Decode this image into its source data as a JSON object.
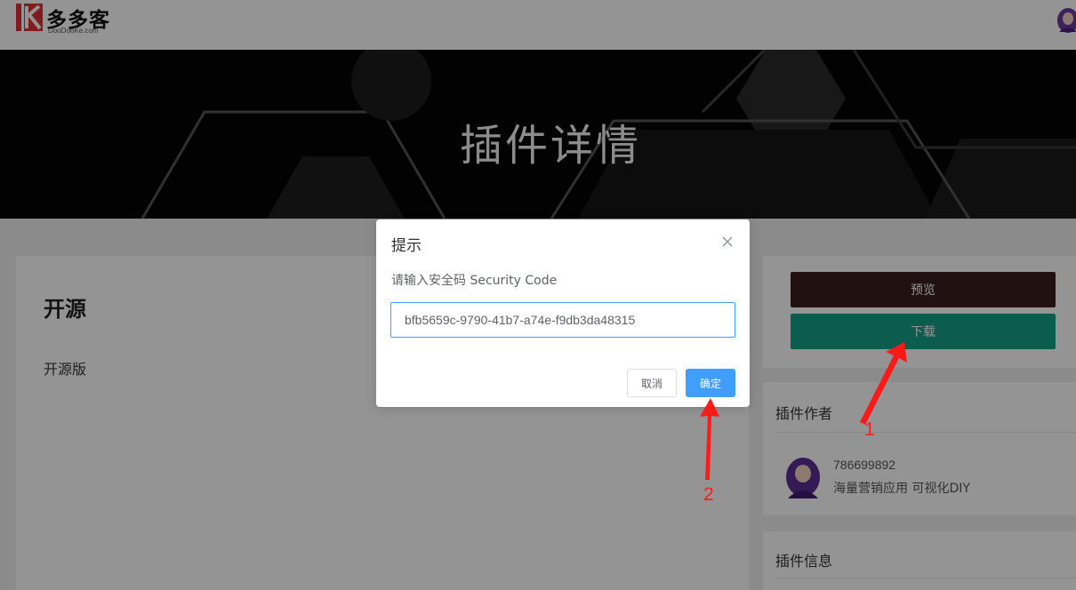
{
  "header": {
    "logo_text": "多多客",
    "logo_subtext": "DooDooKe.com"
  },
  "banner": {
    "title": "插件详情"
  },
  "main": {
    "heading": "开源",
    "subheading": "开源版"
  },
  "side": {
    "preview_label": "预览",
    "download_label": "下载",
    "author_heading": "插件作者",
    "author_id": "786699892",
    "author_desc": "海量营销应用 可视化DIY",
    "info_heading": "插件信息"
  },
  "modal": {
    "title": "提示",
    "message": "请输入安全码 Security Code",
    "input_value": "bfb5659c-9790-41b7-a74e-f9db3da48315",
    "cancel_label": "取消",
    "confirm_label": "确定"
  },
  "annotations": {
    "label_1": "1",
    "label_2": "2"
  },
  "colors": {
    "download_green": "#16a085",
    "preview_dark": "#3a1e1e",
    "primary_blue": "#409eff",
    "annotation_red": "#ff1a1a",
    "logo_red": "#e03030"
  }
}
